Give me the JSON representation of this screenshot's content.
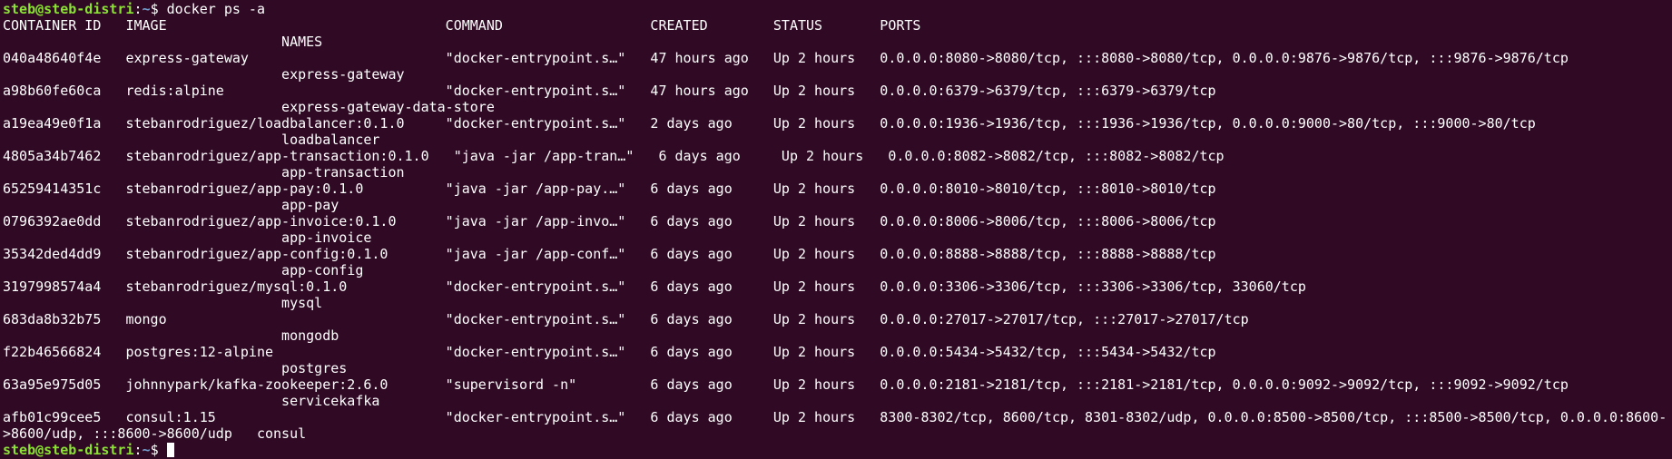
{
  "terminal": {
    "prompt": {
      "user_host": "steb@steb-distri",
      "separator": ":",
      "path": "~",
      "symbol": "$ "
    },
    "command": "docker ps -a",
    "header": {
      "line1": "CONTAINER ID   IMAGE                                  COMMAND                  CREATED        STATUS       PORTS",
      "line2": "                                  NAMES"
    },
    "rows": [
      {
        "id": "040a48640f4e",
        "line1": "040a48640f4e   express-gateway                        \"docker-entrypoint.s…\"   47 hours ago   Up 2 hours   0.0.0.0:8080->8080/tcp, :::8080->8080/tcp, 0.0.0.0:9876->9876/tcp, :::9876->9876/tcp",
        "line2": "                                  express-gateway"
      },
      {
        "id": "a98b60fe60ca",
        "line1": "a98b60fe60ca   redis:alpine                           \"docker-entrypoint.s…\"   47 hours ago   Up 2 hours   0.0.0.0:6379->6379/tcp, :::6379->6379/tcp",
        "line2": "                                  express-gateway-data-store"
      },
      {
        "id": "a19ea49e0f1a",
        "line1": "a19ea49e0f1a   stebanrodriguez/loadbalancer:0.1.0     \"docker-entrypoint.s…\"   2 days ago     Up 2 hours   0.0.0.0:1936->1936/tcp, :::1936->1936/tcp, 0.0.0.0:9000->80/tcp, :::9000->80/tcp",
        "line2": "                                  loadbalancer"
      },
      {
        "id": "4805a34b7462",
        "line1": "4805a34b7462   stebanrodriguez/app-transaction:0.1.0   \"java -jar /app-tran…\"   6 days ago     Up 2 hours   0.0.0.0:8082->8082/tcp, :::8082->8082/tcp",
        "line2": "                                  app-transaction"
      },
      {
        "id": "65259414351c",
        "line1": "65259414351c   stebanrodriguez/app-pay:0.1.0          \"java -jar /app-pay.…\"   6 days ago     Up 2 hours   0.0.0.0:8010->8010/tcp, :::8010->8010/tcp",
        "line2": "                                  app-pay"
      },
      {
        "id": "0796392ae0dd",
        "line1": "0796392ae0dd   stebanrodriguez/app-invoice:0.1.0      \"java -jar /app-invo…\"   6 days ago     Up 2 hours   0.0.0.0:8006->8006/tcp, :::8006->8006/tcp",
        "line2": "                                  app-invoice"
      },
      {
        "id": "35342ded4dd9",
        "line1": "35342ded4dd9   stebanrodriguez/app-config:0.1.0       \"java -jar /app-conf…\"   6 days ago     Up 2 hours   0.0.0.0:8888->8888/tcp, :::8888->8888/tcp",
        "line2": "                                  app-config"
      },
      {
        "id": "3197998574a4",
        "line1": "3197998574a4   stebanrodriguez/mysql:0.1.0            \"docker-entrypoint.s…\"   6 days ago     Up 2 hours   0.0.0.0:3306->3306/tcp, :::3306->3306/tcp, 33060/tcp",
        "line2": "                                  mysql"
      },
      {
        "id": "683da8b32b75",
        "line1": "683da8b32b75   mongo                                  \"docker-entrypoint.s…\"   6 days ago     Up 2 hours   0.0.0.0:27017->27017/tcp, :::27017->27017/tcp",
        "line2": "                                  mongodb"
      },
      {
        "id": "f22b46566824",
        "line1": "f22b46566824   postgres:12-alpine                     \"docker-entrypoint.s…\"   6 days ago     Up 2 hours   0.0.0.0:5434->5432/tcp, :::5434->5432/tcp",
        "line2": "                                  postgres"
      },
      {
        "id": "63a95e975d05",
        "line1": "63a95e975d05   johnnypark/kafka-zookeeper:2.6.0       \"supervisord -n\"         6 days ago     Up 2 hours   0.0.0.0:2181->2181/tcp, :::2181->2181/tcp, 0.0.0.0:9092->9092/tcp, :::9092->9092/tcp",
        "line2": "                                  servicekafka"
      },
      {
        "id": "afb01c99cee5",
        "line1": "afb01c99cee5   consul:1.15                            \"docker-entrypoint.s…\"   6 days ago     Up 2 hours   8300-8302/tcp, 8600/tcp, 8301-8302/udp, 0.0.0.0:8500->8500/tcp, :::8500->8500/tcp, 0.0.0.0:8600-",
        "line2": ">8600/udp, :::8600->8600/udp   consul"
      }
    ]
  }
}
